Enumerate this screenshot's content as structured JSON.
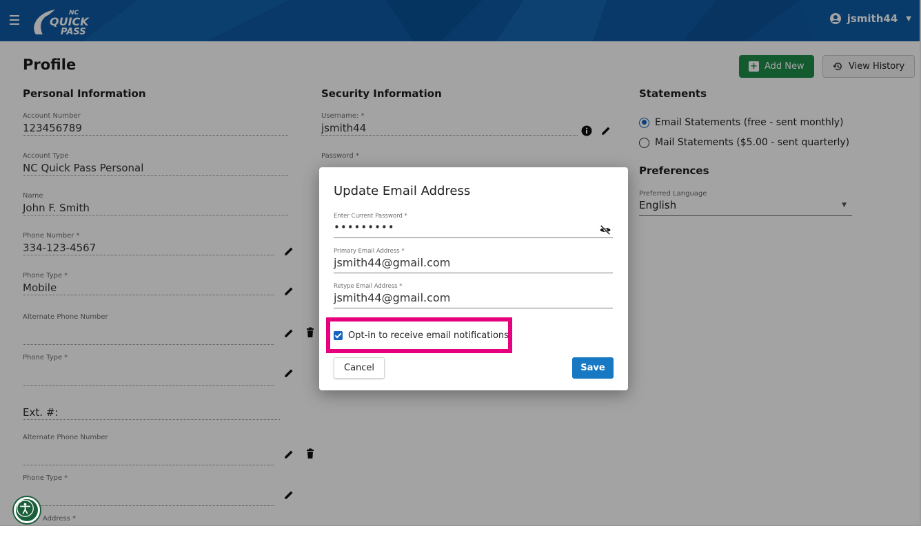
{
  "header": {
    "logo_top": "NC",
    "logo_middle": "QUICK",
    "logo_bottom": "PASS",
    "username": "jsmith44",
    "menu_icon": "hamburger-icon",
    "user_icon": "user-circle-icon",
    "dropdown_icon": "caret-down-icon",
    "brand_color": "#0d5aa3"
  },
  "page": {
    "title": "Profile",
    "add_new_label": "Add New",
    "view_history_label": "View History",
    "add_new_color": "#1e8e4a"
  },
  "personal": {
    "heading": "Personal Information",
    "fields": [
      {
        "label": "Account Number",
        "value": "123456789"
      },
      {
        "label": "Account Type",
        "value": "NC Quick Pass Personal"
      },
      {
        "label": "Name",
        "value": "John F. Smith"
      },
      {
        "label": "Phone Number *",
        "value": "334-123-4567"
      },
      {
        "label": "Phone Type *",
        "value": "Mobile"
      },
      {
        "label": "Alternate Phone Number",
        "value": ""
      },
      {
        "label": "Phone Type *",
        "value": ""
      },
      {
        "label": "",
        "value": "Ext. #:"
      },
      {
        "label": "Alternate Phone Number",
        "value": ""
      },
      {
        "label": "Phone Type *",
        "value": ""
      },
      {
        "label": "Address *",
        "value": ""
      }
    ]
  },
  "security": {
    "heading": "Security Information",
    "username_label": "Username: *",
    "username_value": "jsmith44",
    "password_label": "Password *"
  },
  "statements": {
    "heading": "Statements",
    "options": [
      {
        "label": "Email Statements (free - sent monthly)",
        "selected": true
      },
      {
        "label": "Mail Statements ($5.00 - sent quarterly)",
        "selected": false
      }
    ]
  },
  "preferences": {
    "heading": "Preferences",
    "language_label": "Preferred Language",
    "language_value": "English"
  },
  "modal": {
    "title": "Update Email Address",
    "password_label": "Enter Current Password *",
    "password_value": "•••••••••",
    "primary_email_label": "Primary Email Address *",
    "primary_email_value": "jsmith44@gmail.com",
    "retype_email_label": "Retype Email Address *",
    "retype_email_value": "jsmith44@gmail.com",
    "optin_label": "Opt-in to receive email notifications",
    "optin_checked": true,
    "cancel_label": "Cancel",
    "save_label": "Save",
    "save_color": "#1779c4",
    "highlight_color": "#e6007e"
  }
}
